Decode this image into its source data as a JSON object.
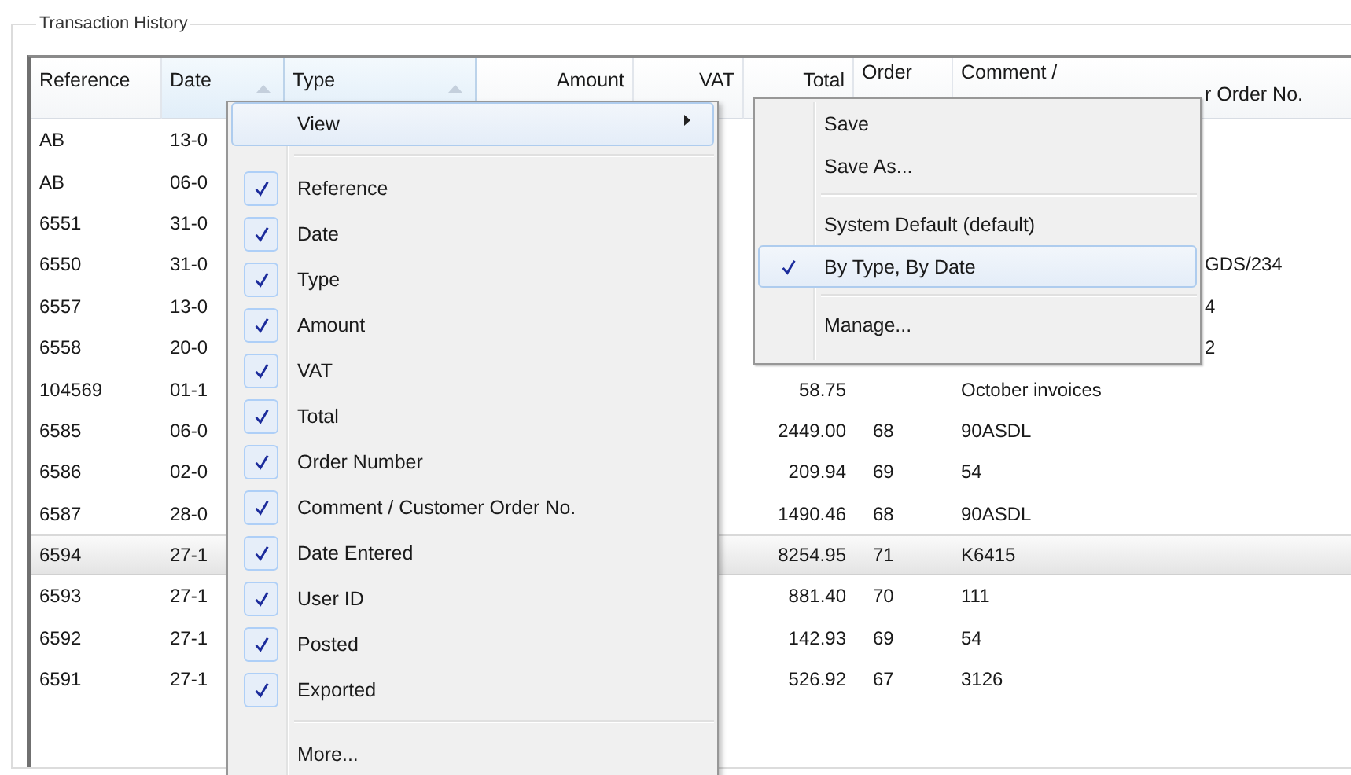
{
  "group_title": "Transaction History",
  "table": {
    "columns": [
      {
        "label": "Reference",
        "sorted": false
      },
      {
        "label": "Date",
        "sorted": true
      },
      {
        "label": "Type",
        "sorted": true
      },
      {
        "label": "Amount",
        "sorted": false
      },
      {
        "label": "VAT",
        "sorted": false
      },
      {
        "label": "Total",
        "sorted": false
      },
      {
        "label": "Order",
        "sorted": false
      },
      {
        "label": "Comment /",
        "label_tail": "r Order No.",
        "sorted": false
      }
    ],
    "rows": [
      {
        "reference": "AB",
        "date": "13-0",
        "selected": false
      },
      {
        "reference": "AB",
        "date": "06-0",
        "selected": false
      },
      {
        "reference": "6551",
        "date": "31-0",
        "selected": false
      },
      {
        "reference": "6550",
        "date": "31-0",
        "comment_tail": "GDS/234",
        "selected": false
      },
      {
        "reference": "6557",
        "date": "13-0",
        "comment_tail": "4",
        "selected": false
      },
      {
        "reference": "6558",
        "date": "20-0",
        "comment_tail": "2",
        "selected": false
      },
      {
        "reference": "104569",
        "date": "01-1",
        "total": "58.75",
        "comment": "October invoices",
        "selected": false
      },
      {
        "reference": "6585",
        "date": "06-0",
        "total": "2449.00",
        "order": "68",
        "comment": "90ASDL",
        "selected": false
      },
      {
        "reference": "6586",
        "date": "02-0",
        "total": "209.94",
        "order": "69",
        "comment": "54",
        "selected": false
      },
      {
        "reference": "6587",
        "date": "28-0",
        "total": "1490.46",
        "order": "68",
        "comment": "90ASDL",
        "selected": false
      },
      {
        "reference": "6594",
        "date": "27-1",
        "total": "8254.95",
        "order": "71",
        "comment": "K6415",
        "selected": true
      },
      {
        "reference": "6593",
        "date": "27-1",
        "total": "881.40",
        "order": "70",
        "comment": "111",
        "selected": false
      },
      {
        "reference": "6592",
        "date": "27-1",
        "total": "142.93",
        "order": "69",
        "comment": "54",
        "selected": false
      },
      {
        "reference": "6591",
        "date": "27-1",
        "total": "526.92",
        "order": "67",
        "comment": "3126",
        "selected": false
      }
    ]
  },
  "context_menu": {
    "items": [
      {
        "kind": "submenu",
        "label": "View",
        "highlighted": true
      },
      {
        "kind": "separator"
      },
      {
        "kind": "check",
        "label": "Reference",
        "checked": true
      },
      {
        "kind": "check",
        "label": "Date",
        "checked": true
      },
      {
        "kind": "check",
        "label": "Type",
        "checked": true
      },
      {
        "kind": "check",
        "label": "Amount",
        "checked": true
      },
      {
        "kind": "check",
        "label": "VAT",
        "checked": true
      },
      {
        "kind": "check",
        "label": "Total",
        "checked": true
      },
      {
        "kind": "check",
        "label": "Order Number",
        "checked": true
      },
      {
        "kind": "check",
        "label": "Comment / Customer Order No.",
        "checked": true
      },
      {
        "kind": "check",
        "label": "Date Entered",
        "checked": true
      },
      {
        "kind": "check",
        "label": "User ID",
        "checked": true
      },
      {
        "kind": "check",
        "label": "Posted",
        "checked": true
      },
      {
        "kind": "check",
        "label": "Exported",
        "checked": true
      },
      {
        "kind": "separator"
      },
      {
        "kind": "item",
        "label": "More..."
      }
    ]
  },
  "submenu": {
    "items": [
      {
        "kind": "item",
        "label": "Save"
      },
      {
        "kind": "item",
        "label": "Save As..."
      },
      {
        "kind": "separator"
      },
      {
        "kind": "check",
        "label": "System Default (default)",
        "checked": false,
        "highlighted": false
      },
      {
        "kind": "check",
        "label": "By Type, By Date",
        "checked": true,
        "highlighted": true
      },
      {
        "kind": "separator"
      },
      {
        "kind": "item",
        "label": "Manage..."
      }
    ]
  }
}
